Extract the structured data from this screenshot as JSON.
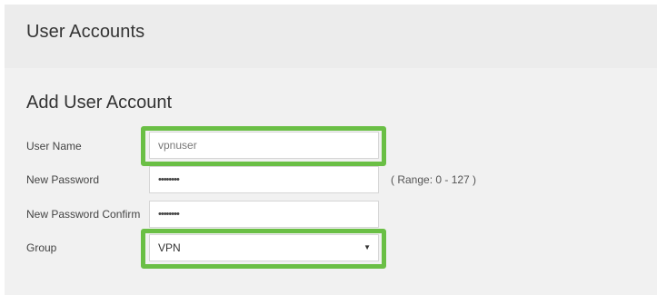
{
  "header": {
    "title": "User Accounts"
  },
  "form": {
    "section_title": "Add User Account",
    "username": {
      "label": "User Name",
      "value": "vpnuser"
    },
    "password": {
      "label": "New Password",
      "value": "••••••••",
      "hint": "( Range: 0 - 127 )"
    },
    "password_confirm": {
      "label": "New Password Confirm",
      "value": "••••••••"
    },
    "group": {
      "label": "Group",
      "value": "VPN"
    }
  },
  "colors": {
    "highlight": "#6abf45",
    "header_bg": "#ececec",
    "panel_bg": "#f1f1f1"
  },
  "icons": {
    "dropdown": "chevron-down-icon"
  }
}
